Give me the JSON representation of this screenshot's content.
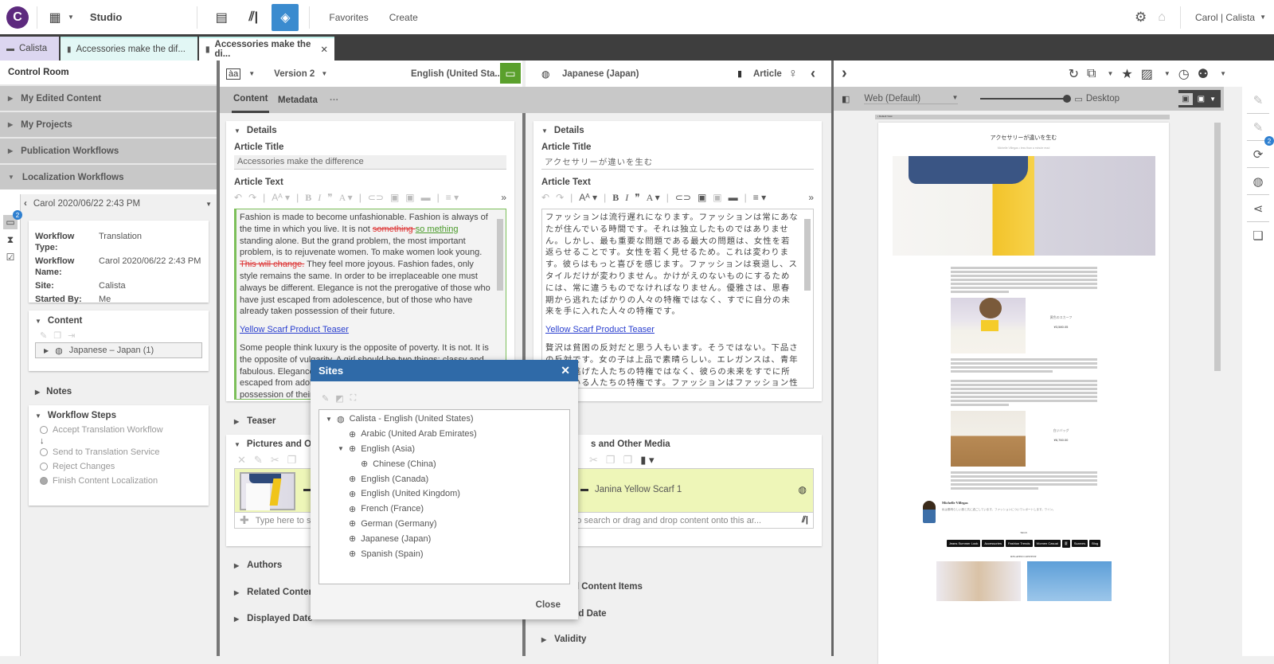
{
  "topbar": {
    "logo_letter": "C",
    "app_name": "Studio",
    "links": [
      "Favorites",
      "Create"
    ],
    "user": "Carol | Calista"
  },
  "tabs": [
    {
      "label": "Calista",
      "active": false
    },
    {
      "label": "Accessories make the dif...",
      "active": false
    },
    {
      "label": "Accessories make the di...",
      "active": true,
      "closable": true
    }
  ],
  "control_room": {
    "title": "Control Room",
    "sections": [
      {
        "label": "My Edited Content",
        "expanded": false
      },
      {
        "label": "My Projects",
        "expanded": false
      },
      {
        "label": "Publication Workflows",
        "expanded": false
      },
      {
        "label": "Localization Workflows",
        "expanded": true
      }
    ],
    "inbox_badge": "2",
    "workflow_header": "Carol 2020/06/22 2:43 PM",
    "workflow_details": [
      {
        "key": "Workflow Type:",
        "value": "Translation"
      },
      {
        "key": "Workflow Name:",
        "value": "Carol 2020/06/22 2:43 PM"
      },
      {
        "key": "Site:",
        "value": "Calista"
      },
      {
        "key": "Started By:",
        "value": "Me"
      }
    ],
    "content_title": "Content",
    "content_item": "Japanese – Japan (1)",
    "notes_title": "Notes",
    "steps_title": "Workflow Steps",
    "steps": [
      {
        "label": "Accept Translation Workflow",
        "done": false
      },
      {
        "label": "Send to Translation Service",
        "done": false
      },
      {
        "label": "Reject Changes",
        "done": false
      },
      {
        "label": "Finish Content Localization",
        "done": true
      }
    ]
  },
  "editor": {
    "version": "Version 2",
    "source_locale": "English (United Sta...",
    "target_locale": "Japanese (Japan)",
    "doc_type": "Article",
    "tabs": [
      "Content",
      "Metadata",
      "···"
    ],
    "details_label": "Details",
    "title_label": "Article Title",
    "text_label": "Article Text",
    "source": {
      "title": "Accessories make the difference",
      "para1_a": "Fashion is made to become unfashionable. Fashion is always of the time in which you live. It is not ",
      "para1_del1": "something ",
      "para1_ins1": "so mething ",
      "para1_b": "standing alone. But the grand problem, the most important problem, is to rejuvenate women. To make women look young. ",
      "para1_del2": "This will change.",
      "para1_c": " They feel more joyous. Fashion fades, only style remains the same. In order to be irreplaceable one must always be different. Elegance is not the prerogative of those who have just escaped from adolescence, but of those who have already taken possession of their future.",
      "link": "Yellow Scarf Product Teaser",
      "para2": "Some people think luxury is the opposite of poverty. It is not. It is the opposite of vulgarity. A girl should be two things: classy and fabulous. Elegance is not the prerogative of those who have just escaped from adolescence, but of those who have already taken possession of their future."
    },
    "target": {
      "title": "アクセサリーが違いを生む",
      "para1": "ファッションは流行遅れになります。ファッションは常にあなたが住んでいる時間です。それは独立したものではありません。しかし、最も重要な問題である最大の問題は、女性を若返らせることです。女性を若く見せるため。これは変わります。彼らはもっと喜びを感じます。ファッションは衰退し、スタイルだけが変わりません。かけがえのないものにするためには、常に違うものでなければなりません。優雅さは、思春期から逃れたばかりの人々の特権ではなく、すでに自分の未来を手に入れた人々の特権です。",
      "link": "Yellow Scarf Product Teaser",
      "para2": "贅沢は貧困の反対だと思う人もいます。そうではない。下品さの反対です。女の子は上品で素晴らしい。エレガンスは、青年期から逃げた人たちの特権ではなく、彼らの未来をすでに所有している人たちの特権です。ファッションはファッション性がなくなります。"
    },
    "sections": {
      "teaser": "Teaser",
      "pictures": "Pictures and Other Media",
      "pictures_short": "Pictures and Othe",
      "pictures_right": "s and Other Media",
      "authors": "Authors",
      "related": "Related Content Items",
      "related_short": "Related Content I",
      "related_right": "d Content Items",
      "displayed_date": "Displayed Date",
      "displayed_right": "ed Date",
      "validity": "Validity"
    },
    "media_item": "Janina Yellow Scarf 1",
    "search_placeholder_left": "Type here to s",
    "search_placeholder_right": "e here to search or drag and drop content onto this ar..."
  },
  "preview": {
    "channel": "Web (Default)",
    "device": "Desktop",
    "default_view": "• Default View",
    "article_title": "アクセサリーが違いを生む",
    "byline": "Michelle Villegas • less than a minute read",
    "product1_name": "黄色のスカーフ",
    "product1_price": "¥3,580.05",
    "product2_name": "白いバッグ",
    "product2_price": "¥6,760.00",
    "author_name": "Michelle Villegas",
    "author_bio": "私は素晴らしい服と共に過ごしています。ファッションについてレポートします。ワイン。",
    "tags_label": "TAGS",
    "tags": [
      "Jeans Summer Look",
      "Accessories",
      "Fashion Trends",
      "Women Casual",
      "夏",
      "Scarves",
      "Blog"
    ],
    "related_label": "RELATED CONTENT",
    "sidebar_badge": "2"
  },
  "sites_dialog": {
    "title": "Sites",
    "close_label": "Close",
    "tree": [
      {
        "label": "Calista - English (United States)",
        "level": 0,
        "expanded": true,
        "root": true
      },
      {
        "label": "Arabic (United Arab Emirates)",
        "level": 1
      },
      {
        "label": "English (Asia)",
        "level": 1,
        "expanded": true
      },
      {
        "label": "Chinese (China)",
        "level": 2
      },
      {
        "label": "English (Canada)",
        "level": 1
      },
      {
        "label": "English (United Kingdom)",
        "level": 1
      },
      {
        "label": "French (France)",
        "level": 1
      },
      {
        "label": "German (Germany)",
        "level": 1
      },
      {
        "label": "Japanese (Japan)",
        "level": 1
      },
      {
        "label": "Spanish (Spain)",
        "level": 1
      }
    ]
  }
}
